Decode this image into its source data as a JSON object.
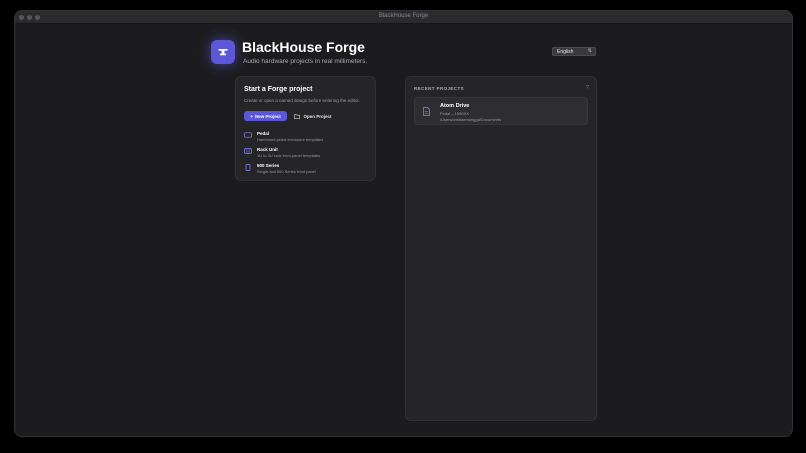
{
  "window": {
    "title": "BlackHouse Forge"
  },
  "brand": {
    "icon": "anvil-icon",
    "title": "BlackHouse Forge",
    "subtitle": "Audio hardware projects in real millimeters."
  },
  "language": {
    "selected": "English"
  },
  "start": {
    "title": "Start a Forge project",
    "description": "Create or open a named design before entering the editor.",
    "new_button": "New Project",
    "open_button": "Open Project",
    "templates": [
      {
        "icon": "pedal-icon",
        "name": "Pedal",
        "desc": "Hammond pedal enclosure templates"
      },
      {
        "icon": "rack-icon",
        "name": "Rack Unit",
        "desc": "1U to 4U rack front-panel templates"
      },
      {
        "icon": "module-icon",
        "name": "500 Series",
        "desc": "Single-slot 500 Series front panel"
      }
    ]
  },
  "recent": {
    "header": "RECENT PROJECTS",
    "help": "?",
    "items": [
      {
        "icon": "document-icon",
        "name": "Atom Drive",
        "meta": "Pedal – 1590XX",
        "path": "/Users/cristianmorigga/Documents"
      }
    ]
  },
  "colors": {
    "accent": "#5b57d6",
    "window_bg": "#1c1c1e",
    "card_bg": "#252528"
  }
}
